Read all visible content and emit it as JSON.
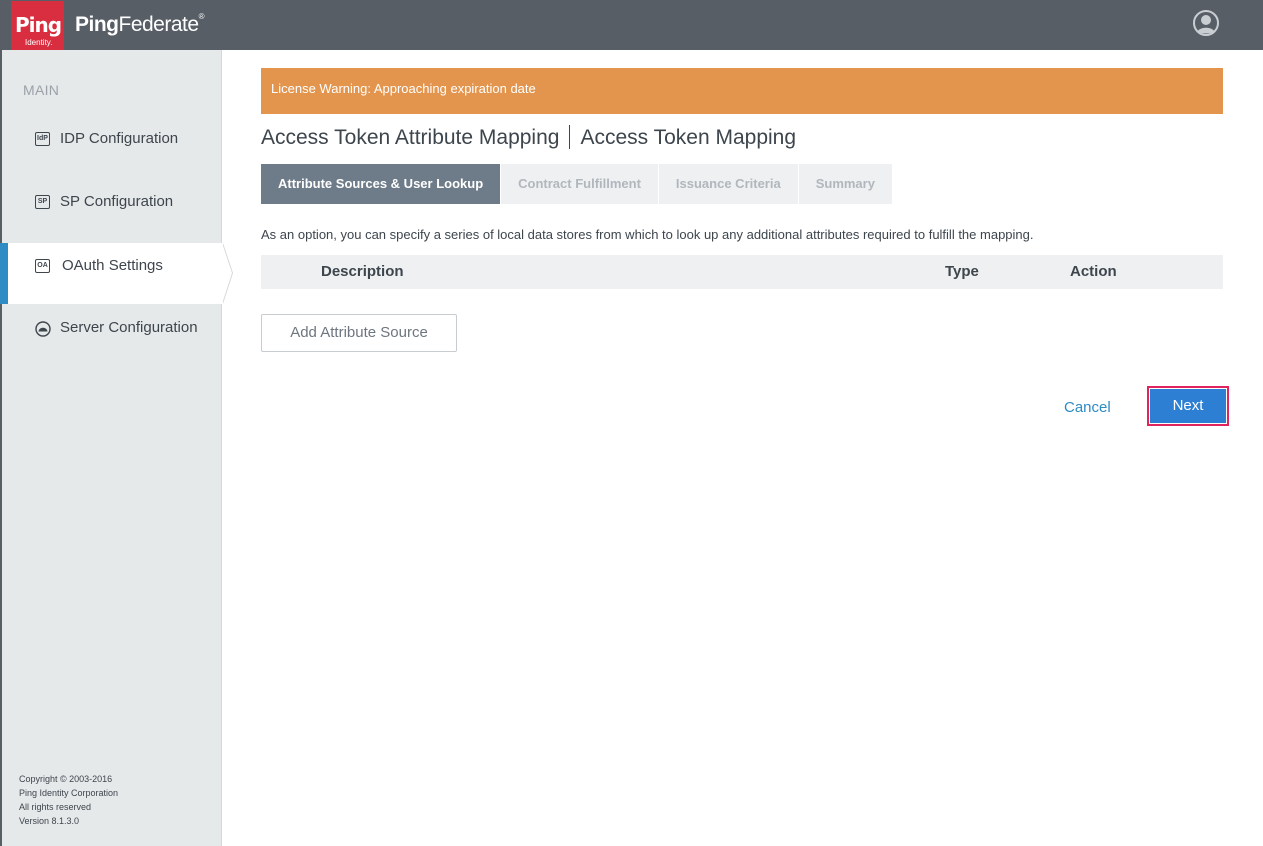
{
  "header": {
    "logo_ping": "Ping",
    "logo_identity": "Identity.",
    "brand_bold": "Ping",
    "brand_light": "Federate",
    "brand_mark": "®",
    "user_icon": "user-avatar-icon"
  },
  "sidebar": {
    "section_label": "MAIN",
    "items": [
      {
        "label": "IDP Configuration",
        "icon_text": "IdP",
        "icon": "idp-icon"
      },
      {
        "label": "SP Configuration",
        "icon_text": "SP",
        "icon": "sp-icon"
      },
      {
        "label": "OAuth Settings",
        "icon_text": "OA",
        "icon": "oauth-icon"
      },
      {
        "label": "Server Configuration",
        "icon": "server-icon"
      }
    ],
    "active_item": "OAuth Settings",
    "copyright": [
      "Copyright © 2003-2016",
      "Ping Identity Corporation",
      "All rights reserved",
      "Version 8.1.3.0"
    ]
  },
  "main": {
    "warning": "License Warning: Approaching expiration date",
    "title_part1": "Access Token Attribute Mapping",
    "title_part2": "Access Token Mapping",
    "tabs": [
      {
        "label": "Attribute Sources & User Lookup",
        "active": true
      },
      {
        "label": "Contract Fulfillment",
        "active": false
      },
      {
        "label": "Issuance Criteria",
        "active": false
      },
      {
        "label": "Summary",
        "active": false
      }
    ],
    "description": "As an option, you can specify a series of local data stores from which to look up any additional attributes required to fulfill the mapping.",
    "table_headers": {
      "description": "Description",
      "type": "Type",
      "action": "Action"
    },
    "add_button": "Add Attribute Source",
    "cancel_label": "Cancel",
    "next_label": "Next"
  },
  "colors": {
    "topbar": "#575e66",
    "logo_red": "#d82e3f",
    "warning": "#e3954e",
    "active_tab": "#6e7b89",
    "accent_blue": "#2e8bc4",
    "next_button": "#2d7fd4",
    "highlight_border": "#e0245e"
  }
}
